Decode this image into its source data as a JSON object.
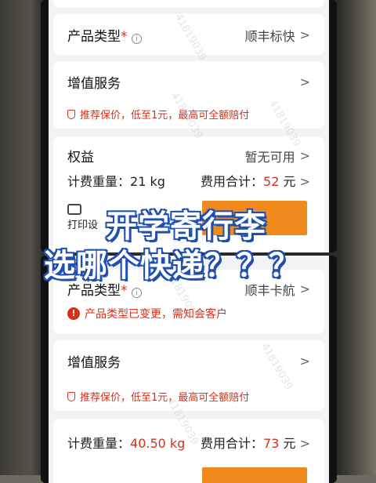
{
  "top_screen": {
    "product_type_label": "产品类型",
    "required_mark": "*",
    "product_type_value": "顺丰标快",
    "value_added_label": "增值服务",
    "insurance_note": "推荐保价，低至1元，最高可全额赔付",
    "rights_label": "权益",
    "rights_value": "暂无可用",
    "weight_label": "计费重量：",
    "weight_value": "21 kg",
    "total_label": "费用合计：",
    "total_value": "52",
    "total_unit": "元",
    "print_label": "打印设"
  },
  "bottom_screen": {
    "product_type_label": "产品类型",
    "required_mark": "*",
    "product_type_value": "顺丰卡航",
    "changed_note": "产品类型已变更，需知会客户",
    "value_added_label": "增值服务",
    "insurance_note": "推荐保价，低至1元，最高可全额赔付",
    "weight_label": "计费重量：",
    "weight_value": "40.50 kg",
    "total_label": "费用合计：",
    "total_value": "73",
    "total_unit": "元"
  },
  "overlay": {
    "line1": "开学寄行李",
    "line2": "选哪个快递？？？"
  },
  "watermark": "41819039",
  "colors": {
    "accent_red": "#d2321c",
    "orange_button": "#f08a1d",
    "overlay_stroke": "#1f4fb0"
  }
}
